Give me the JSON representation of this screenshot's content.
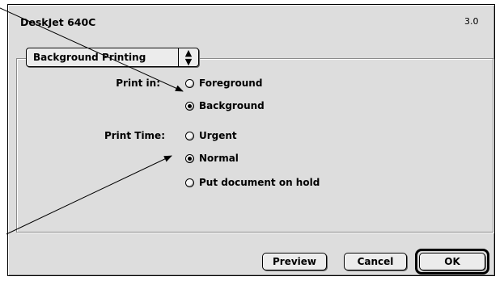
{
  "dialog": {
    "title": "DeskJet 640C",
    "version": "3.0"
  },
  "panel_popup": {
    "selected": "Background Printing",
    "arrow_icon": "updown-arrows-icon"
  },
  "print_in": {
    "label": "Print in:",
    "options": [
      {
        "label": "Foreground",
        "selected": false
      },
      {
        "label": "Background",
        "selected": true
      }
    ]
  },
  "print_time": {
    "label": "Print Time:",
    "options": [
      {
        "label": "Urgent",
        "selected": false
      },
      {
        "label": "Normal",
        "selected": true
      },
      {
        "label": "Put document on hold",
        "selected": false
      }
    ]
  },
  "buttons": {
    "preview": "Preview",
    "cancel": "Cancel",
    "ok": "OK"
  }
}
